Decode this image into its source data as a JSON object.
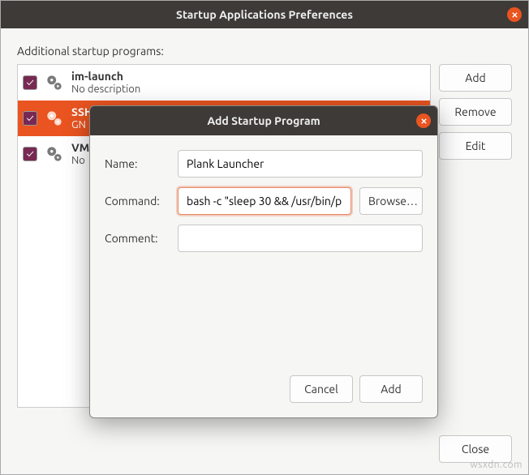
{
  "window": {
    "title": "Startup Applications Preferences",
    "section_label": "Additional startup programs:",
    "buttons": {
      "add": "Add",
      "remove": "Remove",
      "edit": "Edit",
      "close": "Close"
    },
    "programs": [
      {
        "name": "im-launch",
        "desc": "No description",
        "checked": true,
        "selected": false
      },
      {
        "name": "SSH",
        "desc": "GN",
        "checked": true,
        "selected": true
      },
      {
        "name": "VM",
        "desc": "No",
        "checked": true,
        "selected": false
      }
    ]
  },
  "dialog": {
    "title": "Add Startup Program",
    "labels": {
      "name": "Name:",
      "command": "Command:",
      "comment": "Comment:"
    },
    "fields": {
      "name": "Plank Launcher",
      "command": "bash -c \"sleep 30 && /usr/bin/p",
      "comment": ""
    },
    "buttons": {
      "browse": "Browse…",
      "cancel": "Cancel",
      "add": "Add"
    }
  },
  "watermark": "wsxdn.com"
}
